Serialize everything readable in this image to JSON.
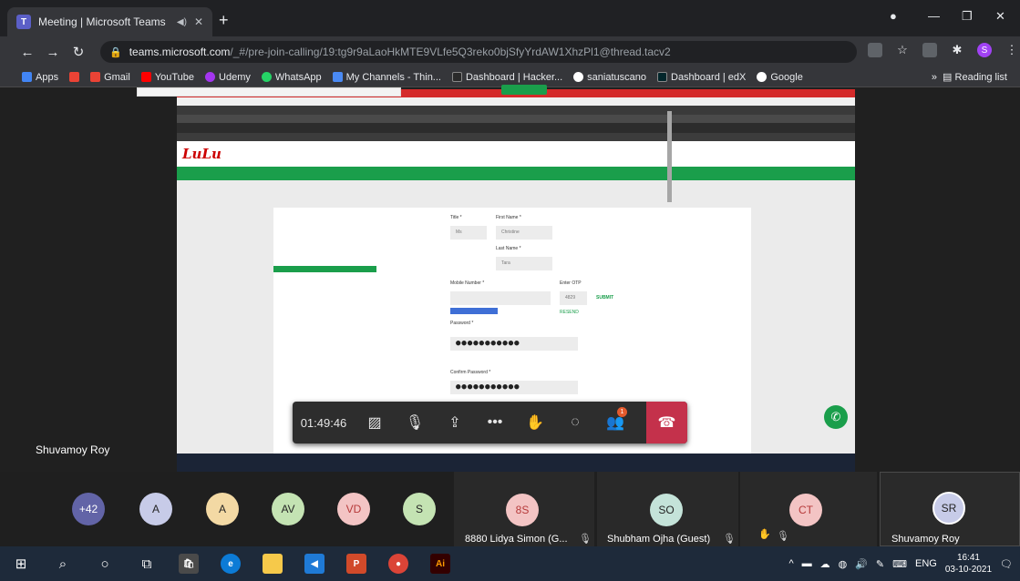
{
  "browser": {
    "tab_title": "Meeting | Microsoft Teams",
    "url_host": "teams.microsoft.com",
    "url_path": "/_#/pre-join-calling/19:tg9r9aLaoHkMTE9VLfe5Q3reko0bjSfyYrdAW1XhzPl1@thread.tacv2",
    "bookmarks": [
      "Apps",
      "Gmail",
      "YouTube",
      "Udemy",
      "WhatsApp",
      "My Channels - Thin...",
      "Dashboard | Hacker...",
      "saniatuscano",
      "Dashboard | edX",
      "Google"
    ],
    "reading_list": "Reading list",
    "profile_initial": "S"
  },
  "shared_screen": {
    "site_logo": "LuLu",
    "form": {
      "title_label": "Title *",
      "title_value": "Ms",
      "first_name_label": "First Name *",
      "first_name_value": "Christine",
      "last_name_label": "Last Name *",
      "last_name_value": "Tara",
      "mobile_label": "Mobile Number *",
      "otp_label": "Enter OTP",
      "otp_value": "4829",
      "submit_label": "SUBMIT",
      "resend_label": "RESEND",
      "password_label": "Password *",
      "password_value": "●●●●●●●●●●●",
      "confirm_password_label": "Confirm Password *",
      "confirm_password_value": "●●●●●●●●●●●"
    }
  },
  "call": {
    "timer": "01:49:46",
    "participants_badge": "1",
    "presenter_name": "Shuvamoy Roy"
  },
  "participants": [
    {
      "initials": "+42",
      "name": ""
    },
    {
      "initials": "A",
      "name": ""
    },
    {
      "initials": "A",
      "name": ""
    },
    {
      "initials": "AV",
      "name": ""
    },
    {
      "initials": "VD",
      "name": ""
    },
    {
      "initials": "S",
      "name": ""
    },
    {
      "initials": "8S",
      "name": "8880 Lidya Simon (G..."
    },
    {
      "initials": "SO",
      "name": "Shubham Ojha (Guest)"
    },
    {
      "initials": "CT",
      "name": ""
    },
    {
      "initials": "SR",
      "name": "Shuvamoy Roy"
    }
  ],
  "taskbar": {
    "language": "ENG",
    "time": "16:41",
    "date": "03-10-2021"
  },
  "colors": {
    "teams_purple": "#6264a7",
    "hangup_red": "#c4314b",
    "lulu_green": "#1a9e4b"
  }
}
